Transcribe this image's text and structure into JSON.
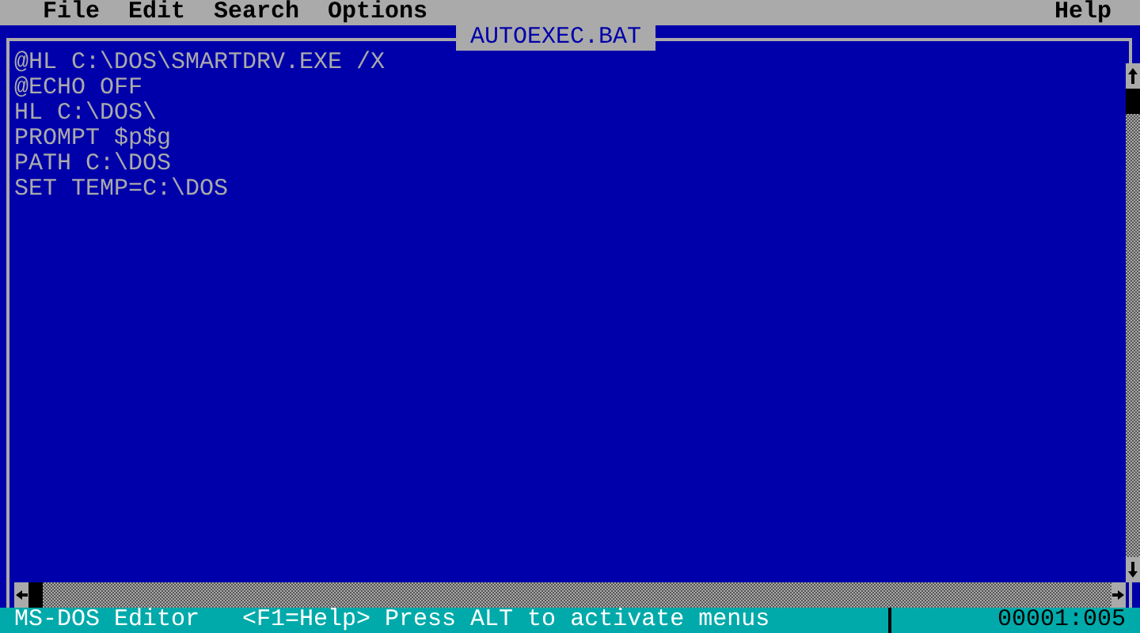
{
  "menu": [
    {
      "label": "File"
    },
    {
      "label": "Edit"
    },
    {
      "label": "Search"
    },
    {
      "label": "Options"
    }
  ],
  "help_menu": {
    "label": "Help"
  },
  "editor": {
    "title": "AUTOEXEC.BAT",
    "lines": [
      "@HL C:\\DOS\\SMARTDRV.EXE /X",
      "@ECHO OFF",
      "HL C:\\DOS\\",
      "PROMPT $p$g",
      "PATH C:\\DOS",
      "SET TEMP=C:\\DOS"
    ]
  },
  "status_bar": {
    "app": "MS-DOS Editor",
    "hint": "<F1=Help> Press ALT to activate menus",
    "position": "00001:005"
  }
}
